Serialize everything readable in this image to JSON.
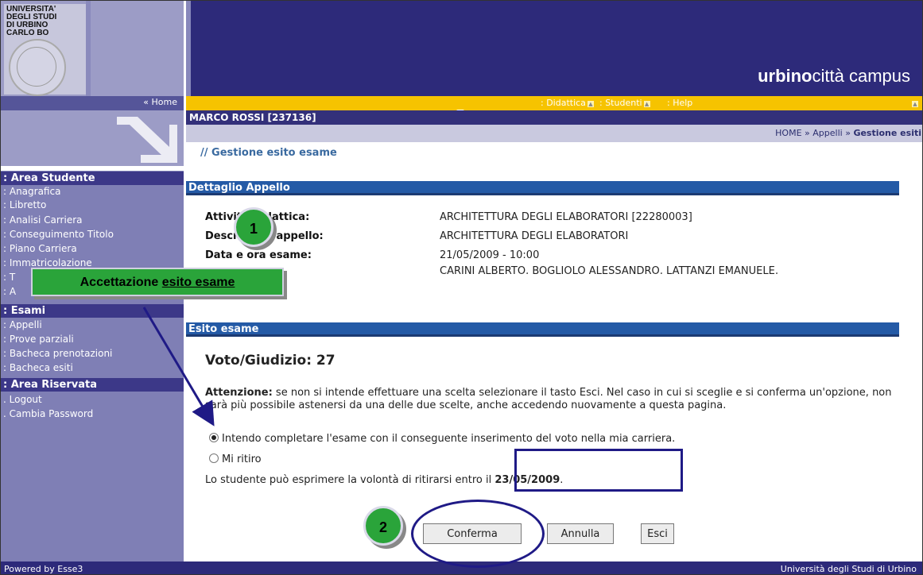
{
  "header": {
    "logo_lines": [
      "UNIVERSITA'",
      "DEGLI STUDI",
      "DI URBINO",
      "CARLO BO"
    ],
    "brand_bold": "urbino",
    "brand_rest": "città campus"
  },
  "nav": {
    "home": "« Home",
    "tabs": [
      ": Didattica",
      ": Studenti",
      ": Help"
    ]
  },
  "sidebar": {
    "sections": [
      {
        "title": ": Area Studente",
        "items": [
          ": Anagrafica",
          ": Libretto",
          ": Analisi Carriera",
          ": Conseguimento Titolo",
          ": Piano Carriera",
          ": Immatricolazione",
          ": T",
          ": A"
        ]
      },
      {
        "title": ": Esami",
        "items": [
          ": Appelli",
          ": Prove parziali",
          ": Bacheca prenotazioni",
          ": Bacheca esiti"
        ]
      },
      {
        "title": ": Area Riservata",
        "items": [
          ". Logout",
          ". Cambia Password"
        ]
      }
    ]
  },
  "user": {
    "name": "MARCO ROSSI [237136]"
  },
  "breadcrumb": {
    "home": "HOME",
    "sep": " » ",
    "appelli": "Appelli",
    "current": "Gestione esiti"
  },
  "page": {
    "title": "// Gestione esito esame"
  },
  "detail": {
    "header": "Dettaglio Appello",
    "rows": [
      {
        "label": "Attività Didattica:",
        "value": "ARCHITETTURA DEGLI ELABORATORI [22280003]"
      },
      {
        "label": "Descrizione appello:",
        "value": "ARCHITETTURA DEGLI ELABORATORI"
      },
      {
        "label": "Data e ora esame:",
        "value": "21/05/2009 - 10:00"
      },
      {
        "label": "",
        "value": "CARINI ALBERTO, BOGLIOLO ALESSANDRO, LATTANZI EMANUELE,"
      }
    ]
  },
  "result": {
    "header": "Esito esame",
    "grade_label": "Voto/Giudizio:",
    "grade_value": "27",
    "warning_bold": "Attenzione:",
    "warning_text": " se non si intende effettuare una scelta selezionare il tasto Esci. Nel caso in cui si sceglie e si conferma un'opzione, non sarà più possibile astenersi da una delle due scelte, anche accedendo nuovamente a questa pagina.",
    "option_accept": "Intendo completare l'esame con il conseguente inserimento del voto nella mia carriera.",
    "option_withdraw": "Mi ritiro",
    "selected": "accept",
    "deadline_prefix": "Lo studente può esprimere la volontà di ritirarsi entro il ",
    "deadline_date": "23/05/2009",
    "deadline_suffix": "."
  },
  "buttons": {
    "confirm": "Conferma",
    "cancel": "Annulla",
    "exit": "Esci"
  },
  "footer": {
    "powered": "Powered by Esse3",
    "university": "Università degli Studi di Urbino"
  },
  "annotations": {
    "badge1": "1",
    "badge2": "2",
    "callout_prefix": "Accettazione ",
    "callout_underlined": "esito esame"
  },
  "colors": {
    "header_dark": "#2d2a7a",
    "nav_yellow": "#f6c300",
    "sidebar": "#7f7fb5",
    "panel_blue": "#245aa6",
    "annotation_green": "#2aa43a",
    "annotation_outline": "#1f1a86"
  }
}
